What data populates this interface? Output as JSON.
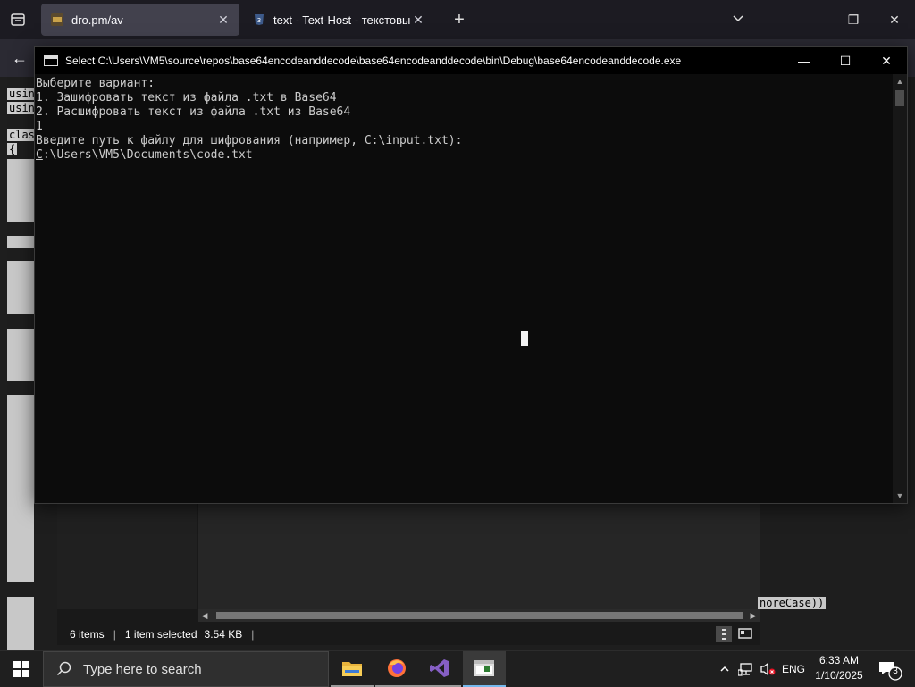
{
  "browser": {
    "tabs": [
      {
        "label": "dro.pm/av",
        "active": true
      },
      {
        "label": "text - Text-Host - текстовый хо",
        "active": false
      }
    ],
    "icons": {
      "tab_manager": "tab-manager-icon",
      "new_tab": "plus-icon",
      "list_tabs": "chevron-down-icon",
      "back": "arrow-left-icon"
    }
  },
  "background": {
    "code_fragments": [
      "usin",
      "usin",
      "clas",
      "{"
    ],
    "right_fragment": "noreCase))"
  },
  "explorer": {
    "status": {
      "items": "6 items",
      "selected": "1 item selected",
      "size": "3.54 KB"
    }
  },
  "console": {
    "title": "Select C:\\Users\\VM5\\source\\repos\\base64encodeanddecode\\base64encodeanddecode\\bin\\Debug\\base64encodeanddecode.exe",
    "lines": [
      "Выберите вариант:",
      "1. Зашифровать текст из файла .txt в Base64",
      "2. Расшифровать текст из файла .txt из Base64",
      "1",
      "Введите путь к файлу для шифрования (например, C:\\input.txt):"
    ],
    "input_first_char": "C",
    "input_rest": ":\\Users\\VM5\\Documents\\code.txt"
  },
  "taskbar": {
    "search_placeholder": "Type here to search",
    "apps": [
      "file-explorer",
      "firefox",
      "visual-studio",
      "console"
    ],
    "language": "ENG",
    "time": "6:33 AM",
    "date": "1/10/2025",
    "notification_count": "3"
  },
  "colors": {
    "console_bg": "#0c0c0c",
    "console_text": "#cccccc",
    "taskbar_bg": "#1f1f1f",
    "tab_active_bg": "#42414d",
    "accent": "#76b9ed"
  }
}
